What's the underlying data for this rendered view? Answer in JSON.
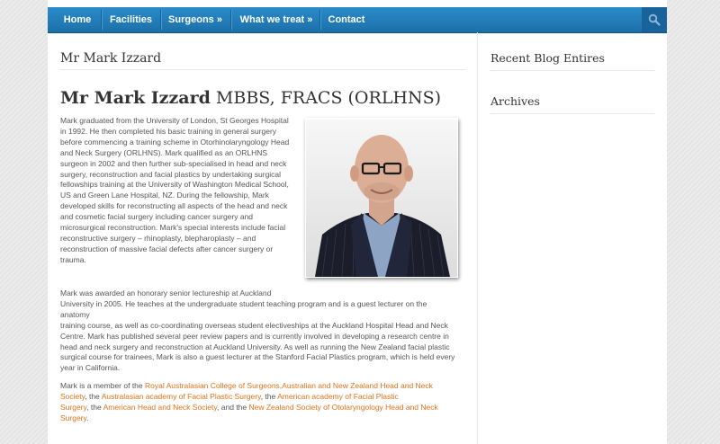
{
  "nav": {
    "items": [
      "Home",
      "Facilities",
      "Surgeons  »",
      "What we treat  »",
      "Contact"
    ]
  },
  "page_title": "Mr Mark Izzard",
  "heading": {
    "name": "Mr Mark Izzard",
    "credentials": "MBBS, FRACS (ORLHNS)"
  },
  "bio": {
    "para1_lines": [
      "Mark graduated from the University of London, St Georges Hospital",
      "in 1992. He then completed his basic training in general surgery",
      "before commencing a training scheme in Otorhinolaryngology Head",
      "and Neck Surgery (ORLHNS). Mark qualified as an ORLHNS",
      "surgeon in 2002 and then further sub-specialised in head and neck",
      "surgery, reconstruction and facial plastics by undertaking surgical",
      "fellowships training at the University of Washington Medical School,",
      "US and Green Lane Hospital, NZ. During the fellowship, Mark",
      "developed skills for reconstructing all aspects of the head and neck",
      "and cosmetic facial surgery including cancer surgery and",
      "microsurgical reconstruction. Mark's special interests include facial",
      "reconstructive surgery – rhinoplasty, blepharoplasty – and",
      "reconstruction of massive facial defects after cancer surgery or",
      "trauma."
    ],
    "para2_lines": [
      "Mark was awarded an honorary senior lectureship at Auckland",
      "University in 2005. He teaches at the undergraduate student teaching program and is a guest lecturer on the anatomy",
      "training course, as well as co-coordinating overseas student electiveships at the Auckland Hospital Head and Neck",
      "Centre. Mark has published several peer review papers and is currently involved in developing a research centre in",
      "head and neck surgery and reconstruction at Auckland University. As well as running the New Zealand facial plastic",
      "surgical course for trainees, Mark is also a guest lecturer at the Stanford Facial Plastics program, which is held every",
      "year in California."
    ],
    "para3": {
      "lead": "Mark is a member of the ",
      "link1": "Royal Australasian College of Surgeons,",
      "link2a": "Australian and New Zealand Head and Neck",
      "link2b": "Society",
      "sep1": ", the ",
      "link3": "Australasian academy of Facial Plastic Surgery",
      "sep2": ", the ",
      "link4": "American academy of Facial Plastic",
      "link4b": "Surgery",
      "sep3": ", the ",
      "link5": "American Head and Neck Society",
      "sep4": ", and the ",
      "link6a": "New Zealand Society of Otolaryngology Head and Neck",
      "link6b": "Surgery",
      "end": "."
    }
  },
  "sidebar": {
    "recent_title": "Recent Blog Entires",
    "archives_title": "Archives"
  },
  "colors": {
    "nav": "#1f78b8",
    "link": "#e0731c"
  }
}
